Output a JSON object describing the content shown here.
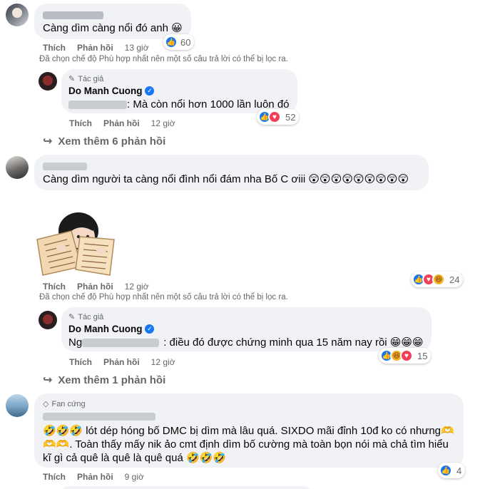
{
  "labels": {
    "like": "Thích",
    "reply": "Phản hồi",
    "author_tag": "Tác giả",
    "fan_tag": "Fan cứng"
  },
  "notice": "Đã chọn chế độ Phù hợp nhất nên một số câu trả lời có thể bị lọc ra.",
  "c1": {
    "text": "Càng dìm càng nổi đó anh 😀",
    "time": "13 giờ",
    "reactions": "60",
    "reply": {
      "author": "Do Manh Cuong",
      "text": ": Mà còn nổi hơn 1000 lần luôn đó",
      "time": "12 giờ",
      "reactions": "52"
    },
    "more": "Xem thêm 6 phản hồi"
  },
  "c2": {
    "text": "Càng dìm người ta càng nổi đình nổi đám nha Bố C ơiii 😲😲😲😲😲😲😲😲😲"
  },
  "c3": {
    "time": "12 giờ",
    "reactions": "24",
    "reply": {
      "author": "Do Manh Cuong",
      "name_prefix": "Ng",
      "text": ": điều đó được chứng minh qua 15 năm nay rồi 😁😁😁",
      "time": "12 giờ",
      "reactions": "15"
    },
    "more": "Xem thêm 1 phản hồi"
  },
  "c4": {
    "line1": "🤣🤣🤣 lót dép hóng bố DMC bị dìm mà lâu quá. SIXDO mãi đỉnh 10đ ko có nhưng🫶",
    "line2": "🫶🫶. Toàn thấy mấy nik ảo cmt định dìm bố cường mà toàn bọn nói mà chả tìm hiểu",
    "line3": "kĩ gì cả quê là quê là quê quá 🤣🤣🤣",
    "time": "9 giờ",
    "reactions": "4"
  },
  "colors": {
    "bubble": "#f0f2f5",
    "meta": "#65676b",
    "like": "#1877f2",
    "love": "#f33e58",
    "haha": "#f7b125"
  }
}
